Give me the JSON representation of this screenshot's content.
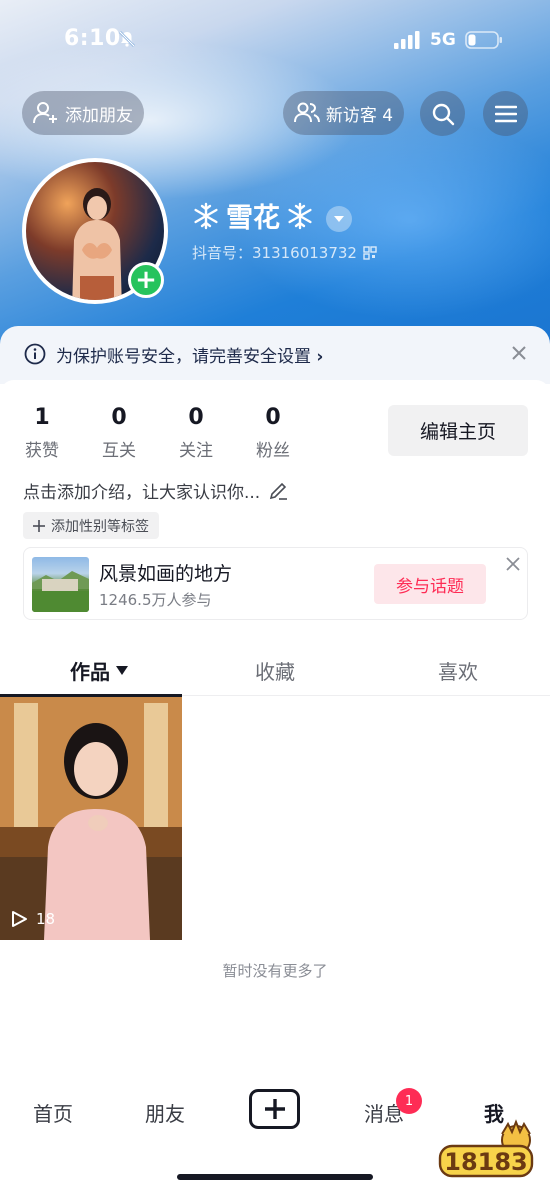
{
  "status_bar": {
    "time": "6:10",
    "network": "5G",
    "icons": [
      "bell-slash-icon",
      "signal-icon",
      "battery-icon"
    ]
  },
  "header": {
    "add_friend_label": "添加朋友",
    "visitors_label": "新访客 4",
    "search_icon": "search-icon",
    "menu_icon": "menu-icon"
  },
  "profile": {
    "nickname": "雪花",
    "douyin_id": "抖音号：31316013732",
    "avatar_badge": "+"
  },
  "notice": {
    "text": "为保护账号安全，请完善安全设置",
    "chevron": "›"
  },
  "stats": [
    {
      "value": "1",
      "label": "获赞"
    },
    {
      "value": "0",
      "label": "互关"
    },
    {
      "value": "0",
      "label": "关注"
    },
    {
      "value": "0",
      "label": "粉丝"
    }
  ],
  "edit_profile_label": "编辑主页",
  "bio": {
    "text": "点击添加介绍，让大家认识你...",
    "tag_label": "添加性别等标签"
  },
  "topic": {
    "title": "风景如画的地方",
    "count": "1246.5万人参与",
    "join_label": "参与话题"
  },
  "tabs": [
    {
      "label": "作品",
      "active": true
    },
    {
      "label": "收藏",
      "active": false
    },
    {
      "label": "喜欢",
      "active": false
    }
  ],
  "video": {
    "play_count": "18"
  },
  "no_more_text": "暂时没有更多了",
  "bottom_nav": {
    "home": "首页",
    "friends": "朋友",
    "messages": "消息",
    "me": "我",
    "message_badge": "1"
  },
  "watermark": "18183",
  "colors": {
    "accent_red": "#fe2c55",
    "online_green": "#26c35d",
    "header_blue": "#1f7fd8"
  }
}
